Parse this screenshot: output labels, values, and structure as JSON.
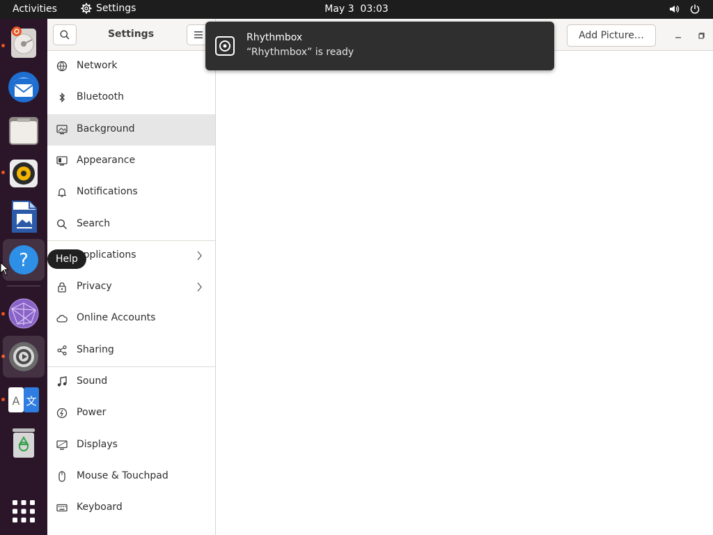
{
  "topbar": {
    "activities": "Activities",
    "app_name": "Settings",
    "date": "May 3",
    "time": "03:03",
    "icons": [
      "volume-icon",
      "power-icon"
    ]
  },
  "dock": {
    "items": [
      {
        "name": "disk-usage-analyzer",
        "running": true
      },
      {
        "name": "thunderbird-mail",
        "running": false
      },
      {
        "name": "files",
        "running": false
      },
      {
        "name": "rhythmbox",
        "running": true
      },
      {
        "name": "libreoffice-writer",
        "running": false
      },
      {
        "name": "help",
        "running": false
      },
      {
        "name": "network-app",
        "running": true
      },
      {
        "name": "settings",
        "running": true
      },
      {
        "name": "language-support",
        "running": true
      },
      {
        "name": "trash",
        "running": false
      },
      {
        "name": "show-applications",
        "running": false
      }
    ],
    "tooltip": "Help"
  },
  "window": {
    "sidebar_title": "Settings",
    "add_picture_label": "Add Picture…",
    "nav_items": [
      {
        "label": "Network",
        "icon": "network-icon",
        "chevron": false
      },
      {
        "label": "Bluetooth",
        "icon": "bluetooth-icon",
        "chevron": false
      },
      {
        "label": "Background",
        "icon": "background-icon",
        "chevron": false,
        "selected": true
      },
      {
        "label": "Appearance",
        "icon": "appearance-icon",
        "chevron": false
      },
      {
        "label": "Notifications",
        "icon": "bell-icon",
        "chevron": false
      },
      {
        "label": "Search",
        "icon": "search-icon",
        "chevron": false
      },
      {
        "label": "Applications",
        "icon": "applications-icon",
        "chevron": true
      },
      {
        "label": "Privacy",
        "icon": "lock-icon",
        "chevron": true
      },
      {
        "label": "Online Accounts",
        "icon": "cloud-icon",
        "chevron": false
      },
      {
        "label": "Sharing",
        "icon": "share-icon",
        "chevron": false
      },
      {
        "label": "Sound",
        "icon": "music-note-icon",
        "chevron": false
      },
      {
        "label": "Power",
        "icon": "power-icon",
        "chevron": false
      },
      {
        "label": "Displays",
        "icon": "display-icon",
        "chevron": false
      },
      {
        "label": "Mouse & Touchpad",
        "icon": "mouse-icon",
        "chevron": false
      },
      {
        "label": "Keyboard",
        "icon": "keyboard-icon",
        "chevron": false
      }
    ]
  },
  "notification": {
    "title": "Rhythmbox",
    "body": "“Rhythmbox” is ready"
  },
  "colors": {
    "topbar": "#1d1d1d",
    "dock": "#2b1629",
    "accent": "#e95420",
    "selected_row": "#e6e6e6",
    "notification_bg": "#2f2f2f"
  }
}
